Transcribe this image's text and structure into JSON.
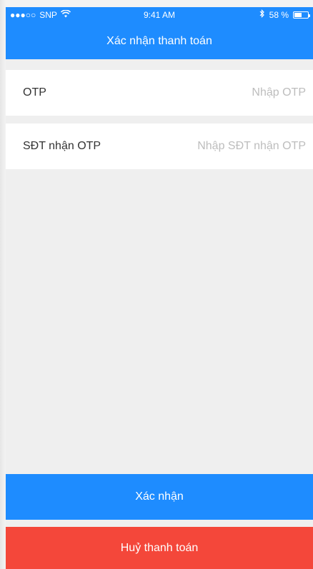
{
  "status_bar": {
    "carrier": "SNP",
    "signal_dots": "●●●○○",
    "time": "9:41 AM",
    "battery_percent": "58 %",
    "battery_level": 0.58
  },
  "nav": {
    "title": "Xác nhận thanh toán"
  },
  "form": {
    "otp": {
      "label": "OTP",
      "placeholder": "Nhập OTP",
      "value": ""
    },
    "phone": {
      "label": "SĐT nhận OTP",
      "placeholder": "Nhập SĐT nhận OTP",
      "value": ""
    }
  },
  "actions": {
    "confirm_label": "Xác nhận",
    "cancel_label": "Huỷ thanh toán"
  },
  "colors": {
    "primary": "#1e8cff",
    "danger": "#f4473a",
    "background": "#efefef"
  },
  "icons": {
    "wifi": "wifi-icon",
    "bluetooth": "bluetooth-icon",
    "battery": "battery-icon"
  }
}
